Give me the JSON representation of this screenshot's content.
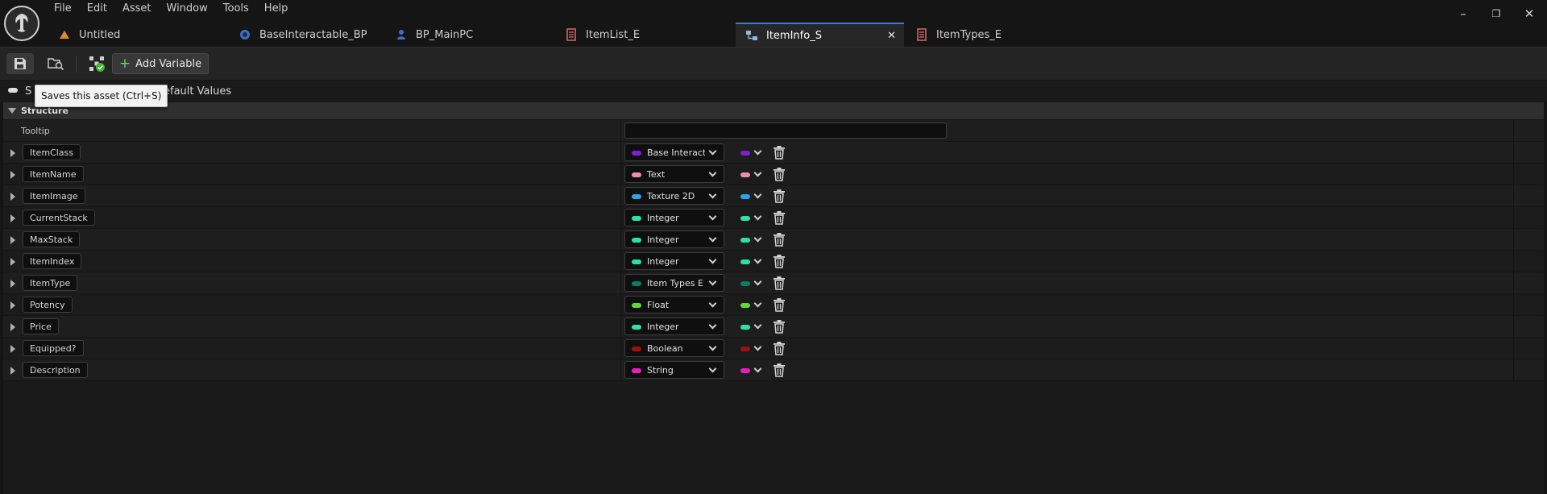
{
  "menu": [
    "File",
    "Edit",
    "Asset",
    "Window",
    "Tools",
    "Help"
  ],
  "tabs": [
    {
      "label": "Untitled",
      "icon": "level-icon"
    },
    {
      "label": "BaseInteractable_BP",
      "icon": "blueprint-actor-icon"
    },
    {
      "label": "BP_MainPC",
      "icon": "blueprint-controller-icon"
    },
    {
      "label": "ItemList_E",
      "icon": "enum-icon"
    },
    {
      "label": "ItemInfo_S",
      "icon": "struct-icon",
      "active": true,
      "close": "✕"
    },
    {
      "label": "ItemTypes_E",
      "icon": "enum-icon"
    }
  ],
  "toolbar": {
    "add_variable_label": "Add Variable",
    "save_tooltip": "Saves this asset (Ctrl+S)"
  },
  "panel_tabs": {
    "structure_partial": "S",
    "default_values": "Default Values"
  },
  "section": {
    "title": "Structure"
  },
  "tooltip_row": {
    "label": "Tooltip",
    "value": ""
  },
  "variables": [
    {
      "name": "ItemClass",
      "type": "Base Interactable BP",
      "color": "#7a1fd4"
    },
    {
      "name": "ItemName",
      "type": "Text",
      "color": "#f08ab0"
    },
    {
      "name": "ItemImage",
      "type": "Texture 2D",
      "color": "#2aa3ea"
    },
    {
      "name": "CurrentStack",
      "type": "Integer",
      "color": "#2de0a5"
    },
    {
      "name": "MaxStack",
      "type": "Integer",
      "color": "#2de0a5"
    },
    {
      "name": "ItemIndex",
      "type": "Integer",
      "color": "#2de0a5"
    },
    {
      "name": "ItemType",
      "type": "Item Types E",
      "color": "#0d7a63"
    },
    {
      "name": "Potency",
      "type": "Float",
      "color": "#62d63a"
    },
    {
      "name": "Price",
      "type": "Integer",
      "color": "#2de0a5"
    },
    {
      "name": "Equipped?",
      "type": "Boolean",
      "color": "#a00f0f"
    },
    {
      "name": "Description",
      "type": "String",
      "color": "#e71fc2"
    }
  ],
  "window_controls": {
    "minimize": "–",
    "restore": "❐",
    "close": "✕"
  }
}
